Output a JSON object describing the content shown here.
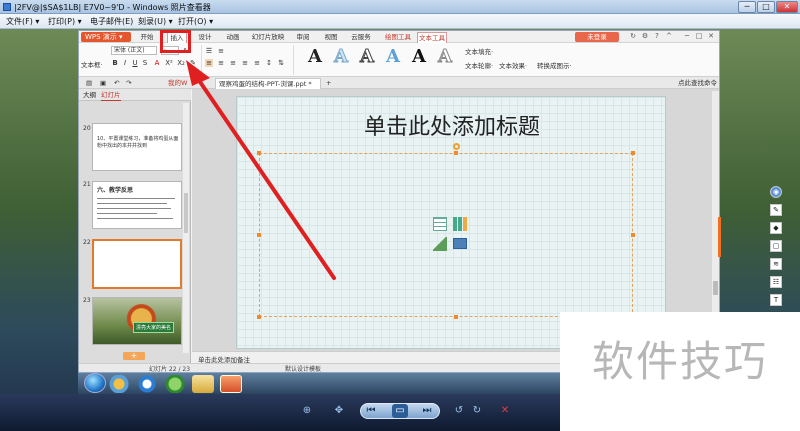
{
  "viewer": {
    "window_title": "|2FV@|$SA$1LB| E7V0~9'D - Windows 照片查看器",
    "menu": [
      "文件(F) ▾",
      "打印(P) ▾",
      "电子邮件(E)",
      "刻录(U) ▾",
      "打开(O) ▾"
    ],
    "window_controls": {
      "minimize": "─",
      "maximize": "□",
      "close": "✕"
    }
  },
  "wps": {
    "app_button": "WPS 演示 ▾",
    "tabs": [
      "开始",
      "插入",
      "设计",
      "动画",
      "幻灯片放映",
      "审阅",
      "视图",
      "云服务",
      "绘图工具",
      "文本工具"
    ],
    "active_tab": "插入",
    "unregistered": "未登录",
    "ribbon": {
      "font_name": "宋体 (正文)",
      "font_size": "·",
      "text_box": "文本框·",
      "text_fill": "文本填充·",
      "text_outline": "文本轮廓·",
      "text_effect": "文本效果·",
      "convert_to_smartart": "转换成图示·",
      "wordart_letter": "A"
    },
    "doc_tabs": {
      "my_wps": "我的W",
      "current_doc": "观察鸡蛋的结构-PPT-浏课.ppt *",
      "add": "+",
      "search_placeholder": "点此查找命令"
    },
    "panel": {
      "tabs": [
        "大纲",
        "幻灯片"
      ],
      "active": "幻灯片",
      "thumbs": [
        {
          "num": "20",
          "text": "10、平置课堂练习，准备将鸡蛋从面粉中找出的本并并找到"
        },
        {
          "num": "21",
          "title": "六、教学反思"
        },
        {
          "num": "22",
          "text": ""
        },
        {
          "num": "23",
          "banner": "漂亮大家的美名"
        }
      ],
      "add_button": "+"
    },
    "slide": {
      "title_placeholder": "单击此处添加标题"
    },
    "notes_placeholder": "单击此处添加备注",
    "status": {
      "slide_count": "幻灯片 22 / 23",
      "template": "默认设计模板"
    }
  },
  "watermark": "软件技巧",
  "colors": {
    "accent_red": "#e02020",
    "wps_orange": "#e4572e",
    "selection_orange": "#f08a2c"
  },
  "icons": {
    "table": "table-icon",
    "chart": "chart-icon",
    "picture": "picture-icon",
    "media": "media-icon"
  }
}
